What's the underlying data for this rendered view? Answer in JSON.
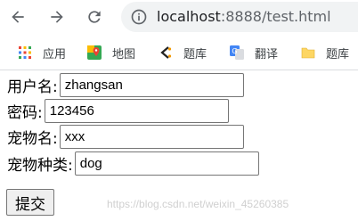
{
  "browser": {
    "back_icon": "arrow-left-icon",
    "forward_icon": "arrow-right-icon",
    "reload_icon": "reload-icon",
    "url_host": "localhost",
    "url_rest": ":8888/test.html"
  },
  "bookmarks": [
    {
      "label": "应用",
      "icon": "apps-grid-icon"
    },
    {
      "label": "地图",
      "icon": "maps-pin-icon"
    },
    {
      "label": "题库",
      "icon": "tiku-logo-icon"
    },
    {
      "label": "翻译",
      "icon": "translate-icon"
    },
    {
      "label": "题库",
      "icon": "folder-icon"
    }
  ],
  "form": {
    "username_label": "用户名:",
    "username_value": "zhangsan",
    "password_label": "密码:",
    "password_value": "123456",
    "petname_label": "宠物名:",
    "petname_value": "xxx",
    "pettype_label": "宠物种类:",
    "pettype_value": "dog",
    "submit_label": "提交"
  },
  "watermark": "https://blog.csdn.net/weixin_45260385"
}
